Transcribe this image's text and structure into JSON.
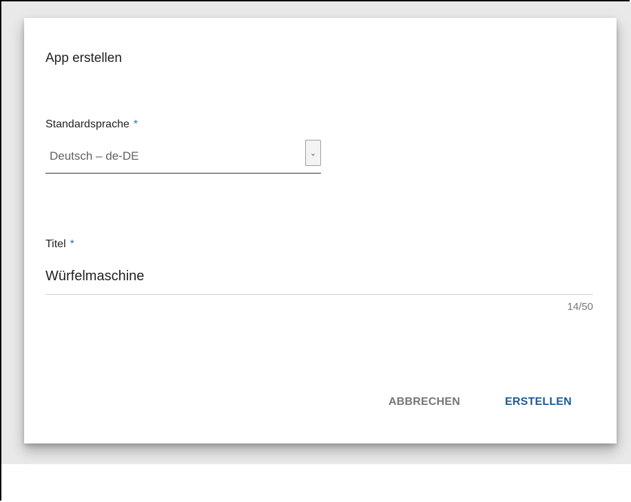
{
  "dialog": {
    "title": "App erstellen",
    "language_field": {
      "label": "Standardsprache",
      "required_marker": "*",
      "value": "Deutsch – de-DE",
      "dropdown_glyph": "⌄"
    },
    "title_field": {
      "label": "Titel",
      "required_marker": "*",
      "value": "Würfelmaschine",
      "counter": "14/50"
    },
    "actions": {
      "cancel_label": "ABBRECHEN",
      "create_label": "ERSTELLEN"
    }
  },
  "colors": {
    "accent": "#1a5b99",
    "required": "#1e73c8",
    "backdrop": "#e9e9e9"
  }
}
